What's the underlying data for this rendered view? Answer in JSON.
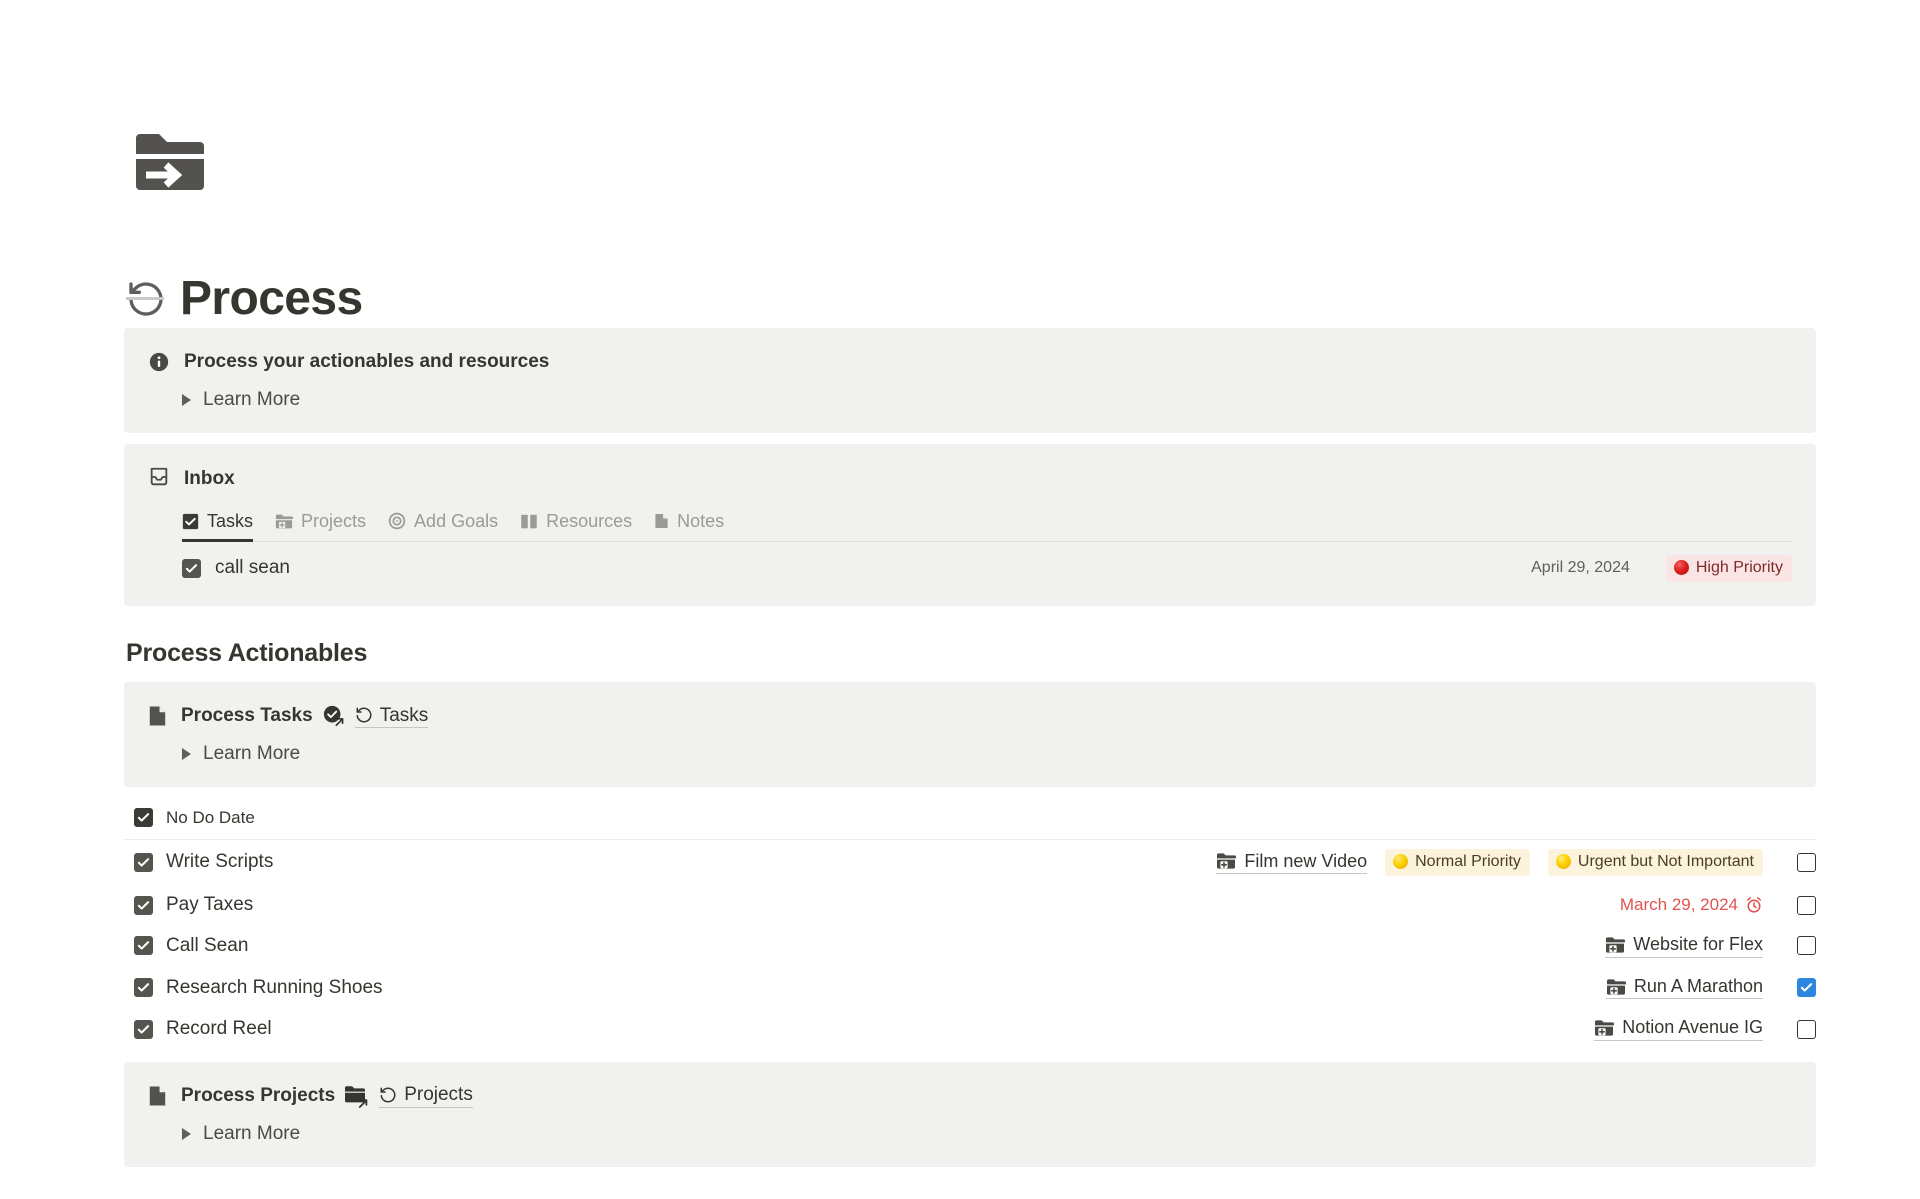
{
  "page": {
    "icon_name": "folder-import-icon",
    "title_emoji_name": "history-rotate-icon",
    "title": "Process"
  },
  "intro_callout": {
    "icon_name": "info-circle-icon",
    "title": "Process your actionables and resources",
    "toggle_label": "Learn More"
  },
  "inbox": {
    "icon_name": "inbox-tray-icon",
    "title": "Inbox",
    "tabs": [
      {
        "label": "Tasks",
        "icon": "checkbox-checked-icon",
        "active": true
      },
      {
        "label": "Projects",
        "icon": "folder-plus-icon",
        "active": false
      },
      {
        "label": "Add Goals",
        "icon": "target-icon",
        "active": false
      },
      {
        "label": "Resources",
        "icon": "open-book-icon",
        "active": false
      },
      {
        "label": "Notes",
        "icon": "note-page-icon",
        "active": false
      }
    ],
    "items": [
      {
        "title": "call sean",
        "checkbox": "dark-checked",
        "date": "April 29, 2024",
        "badge": {
          "label": "High Priority",
          "style": "red",
          "dot": "red-circle"
        }
      }
    ]
  },
  "section": {
    "heading": "Process Actionables"
  },
  "process_tasks_callout": {
    "icon_name": "page-icon",
    "title": "Process Tasks",
    "link_icon_name": "check-circle-arrow-icon",
    "link": {
      "label": "Tasks",
      "icon": "history-rotate-icon"
    },
    "toggle_label": "Learn More"
  },
  "task_list": {
    "group": {
      "label": "No Do Date",
      "checkbox": "dark-checked"
    },
    "rows": [
      {
        "name": "Write Scripts",
        "checkbox": "dark-checked",
        "relation": {
          "label": "Film new Video",
          "icon": "folder-plus-icon"
        },
        "badges": [
          {
            "label": "Normal Priority",
            "style": "yellow",
            "dot": "yellow-circle"
          },
          {
            "label": "Urgent but Not Important",
            "style": "yellow",
            "dot": "yellow-circle"
          }
        ],
        "date": null,
        "end_checkbox": "empty"
      },
      {
        "name": "Pay Taxes",
        "checkbox": "dark-checked",
        "relation": null,
        "badges": [],
        "date": {
          "label": "March 29, 2024",
          "icon": "alarm-clock-icon",
          "overdue": true
        },
        "end_checkbox": "empty"
      },
      {
        "name": "Call Sean",
        "checkbox": "dark-checked",
        "relation": {
          "label": "Website for Flex",
          "icon": "folder-plus-icon"
        },
        "badges": [],
        "date": null,
        "end_checkbox": "empty"
      },
      {
        "name": "Research Running Shoes",
        "checkbox": "dark-checked",
        "relation": {
          "label": "Run A Marathon",
          "icon": "folder-plus-icon"
        },
        "badges": [],
        "date": null,
        "end_checkbox": "blue-checked"
      },
      {
        "name": "Record Reel",
        "checkbox": "dark-checked",
        "relation": {
          "label": "Notion Avenue IG",
          "icon": "folder-plus-icon"
        },
        "badges": [],
        "date": null,
        "end_checkbox": "empty"
      }
    ]
  },
  "process_projects_callout": {
    "icon_name": "page-icon",
    "title": "Process Projects",
    "link_icon_name": "folder-arrow-icon",
    "link": {
      "label": "Projects",
      "icon": "history-rotate-icon"
    },
    "toggle_label": "Learn More"
  },
  "colors": {
    "callout_bg": "#f1f1ef",
    "text": "#37352f",
    "muted": "#9b9a97",
    "badge_red_bg": "#fbe4e4",
    "badge_red_text": "#7e2a2a",
    "badge_yellow_bg": "#fbf3db",
    "badge_yellow_text": "#4b3d1f",
    "checkbox_dark": "#55544f",
    "checkbox_blue": "#2f86e0",
    "overdue_red": "#e0534f"
  }
}
